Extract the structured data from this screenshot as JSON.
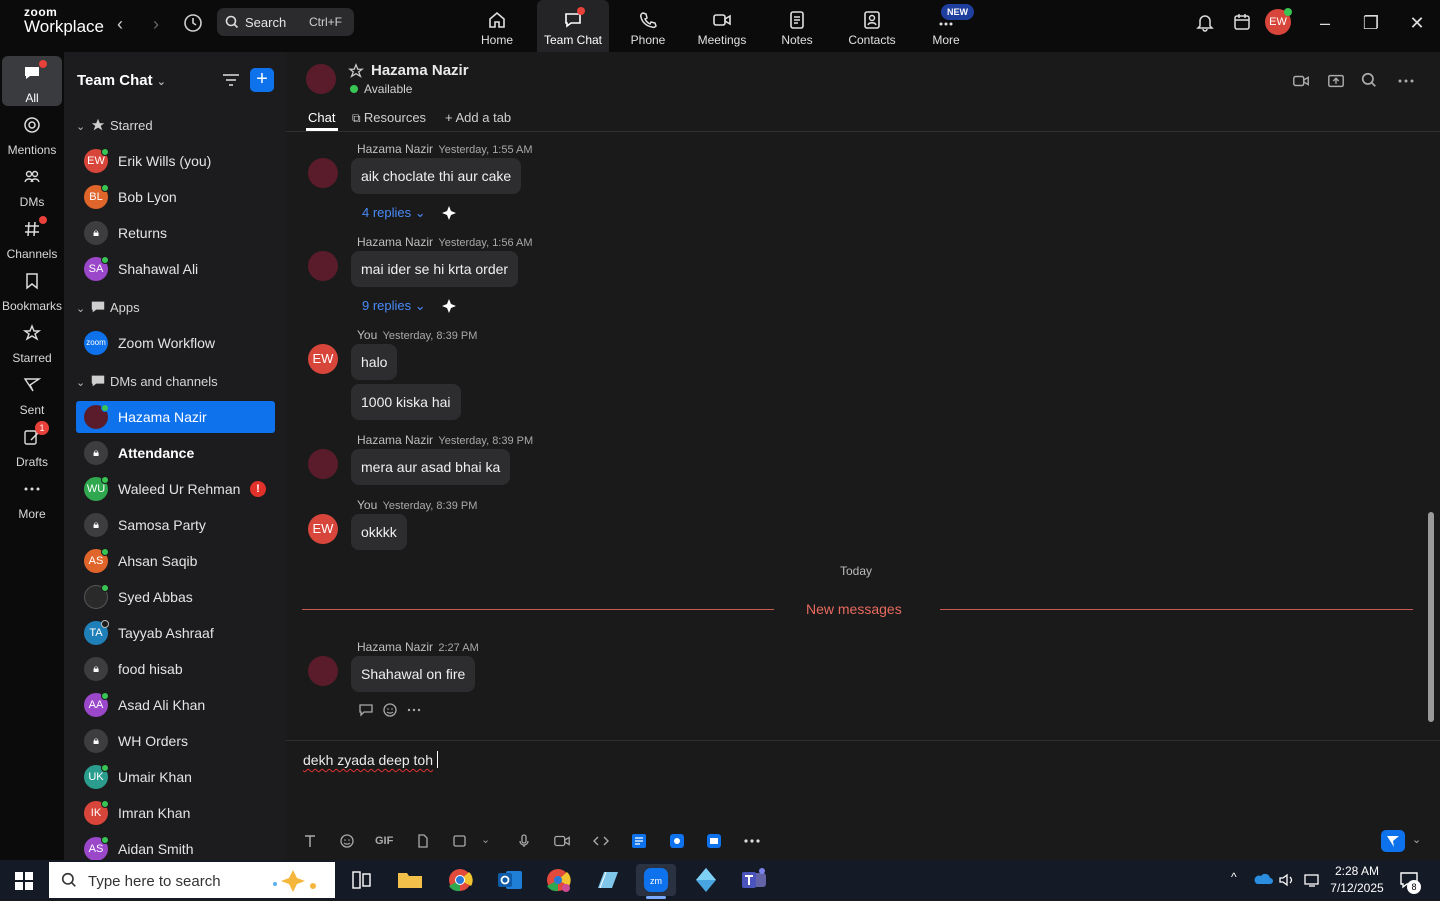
{
  "app": {
    "logo_line1": "zoom",
    "logo_line2": "Workplace"
  },
  "topbar": {
    "search_label": "Search",
    "search_shortcut": "Ctrl+F",
    "tabs": [
      {
        "label": "Home",
        "icon": "home-icon"
      },
      {
        "label": "Team Chat",
        "icon": "chat-icon",
        "active": true
      },
      {
        "label": "Phone",
        "icon": "phone-icon"
      },
      {
        "label": "Meetings",
        "icon": "video-icon"
      },
      {
        "label": "Notes",
        "icon": "notes-icon"
      },
      {
        "label": "Contacts",
        "icon": "contacts-icon"
      },
      {
        "label": "More",
        "icon": "more-icon"
      }
    ],
    "new_badge": "NEW",
    "avatar_initials": "EW"
  },
  "rail": [
    {
      "label": "All",
      "active": true
    },
    {
      "label": "Mentions"
    },
    {
      "label": "DMs"
    },
    {
      "label": "Channels"
    },
    {
      "label": "Bookmarks"
    },
    {
      "label": "Starred"
    },
    {
      "label": "Sent"
    },
    {
      "label": "Drafts",
      "badge": "1"
    },
    {
      "label": "More"
    }
  ],
  "sidebar": {
    "title": "Team Chat",
    "sections": {
      "starred": "Starred",
      "apps": "Apps",
      "dms": "DMs and channels"
    },
    "starred": [
      {
        "label": "Erik Wills (you)",
        "initials": "EW"
      },
      {
        "label": "Bob Lyon",
        "initials": "BL"
      },
      {
        "label": "Returns"
      },
      {
        "label": "Shahawal Ali",
        "initials": "SA"
      }
    ],
    "apps": [
      {
        "label": "Zoom Workflow",
        "initials": "zoom"
      }
    ],
    "dms": [
      {
        "label": "Hazama Nazir"
      },
      {
        "label": "Attendance"
      },
      {
        "label": "Waleed Ur Rehman",
        "initials": "WU",
        "urgent": "!"
      },
      {
        "label": "Samosa Party"
      },
      {
        "label": "Ahsan Saqib",
        "initials": "AS"
      },
      {
        "label": "Syed Abbas"
      },
      {
        "label": "Tayyab Ashraaf",
        "initials": "TA"
      },
      {
        "label": "food hisab"
      },
      {
        "label": "Asad Ali Khan",
        "initials": "AA"
      },
      {
        "label": "WH Orders"
      },
      {
        "label": "Umair Khan",
        "initials": "UK"
      },
      {
        "label": "Imran Khan",
        "initials": "IK"
      },
      {
        "label": "Aidan Smith",
        "initials": "AS"
      }
    ]
  },
  "chat": {
    "name": "Hazama Nazir",
    "status": "Available",
    "tabs": [
      "Chat",
      "Resources",
      "Add a tab"
    ],
    "messages": [
      {
        "sender": "Hazama Nazir",
        "time": "Yesterday, 1:55 AM",
        "text": "aik choclate thi aur cake",
        "replies": "4 replies"
      },
      {
        "sender": "Hazama Nazir",
        "time": "Yesterday, 1:56 AM",
        "text": "mai ider se hi krta order",
        "replies": "9 replies"
      },
      {
        "sender": "You",
        "time": "Yesterday, 8:39 PM",
        "text": "halo",
        "text2": "1000 kiska hai",
        "initials": "EW"
      },
      {
        "sender": "Hazama Nazir",
        "time": "Yesterday, 8:39 PM",
        "text": "mera aur asad bhai ka"
      },
      {
        "sender": "You",
        "time": "Yesterday, 8:39 PM",
        "text": "okkkk",
        "initials": "EW"
      },
      {
        "sender": "Hazama Nazir",
        "time": "2:27 AM",
        "text": "Shahawal on fire"
      }
    ],
    "day_separator": "Today",
    "new_messages": "New messages",
    "composer_text": "dekh zyada deep toh",
    "gif_label": "GIF"
  },
  "taskbar": {
    "search_placeholder": "Type here to search",
    "time": "2:28 AM",
    "date": "7/12/2025",
    "notification_count": "8"
  },
  "colors": {
    "accent": "#0e72ed",
    "presence": "#38c553",
    "alert": "#e8413a",
    "new_messages": "#e86a5f"
  }
}
